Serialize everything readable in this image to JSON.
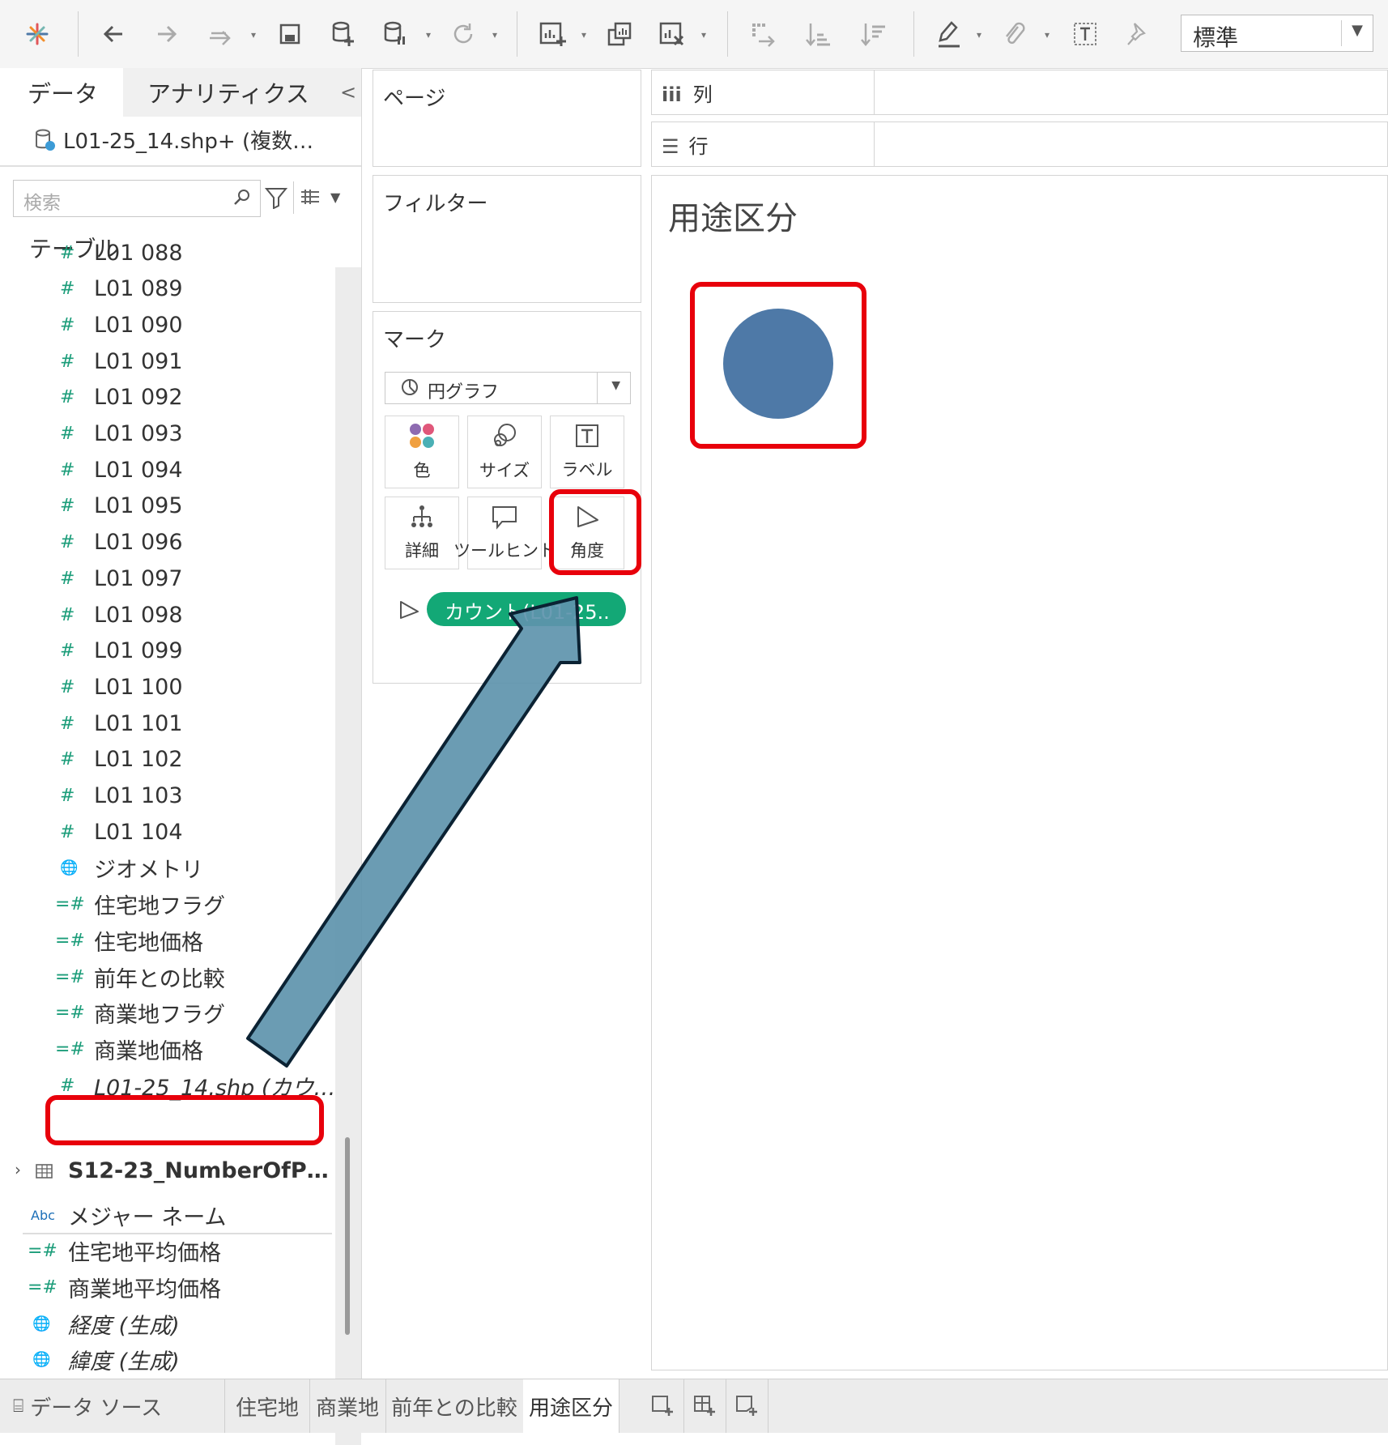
{
  "toolbar": {
    "fit_value": "標準",
    "icons": [
      "tableau-logo-icon",
      "back-icon",
      "forward-icon",
      "redo-icon",
      "save-icon",
      "new-datasource-icon",
      "pause-datasource-icon",
      "refresh-icon",
      "new-worksheet-icon",
      "duplicate-icon",
      "clear-sheet-icon",
      "swap-icon",
      "sort-asc-icon",
      "sort-desc-icon",
      "highlight-icon",
      "annotate-icon",
      "text-icon",
      "pin-icon"
    ]
  },
  "data_pane": {
    "tabs": {
      "data": "データ",
      "analytics": "アナリティクス",
      "collapse": "<"
    },
    "datasource": "L01-25_14.shp+ (複数…",
    "search_placeholder": "検索",
    "tables_header": "テーブル",
    "fields": [
      {
        "type": "measure",
        "label": "L01 088"
      },
      {
        "type": "measure",
        "label": "L01 089"
      },
      {
        "type": "measure",
        "label": "L01 090"
      },
      {
        "type": "measure",
        "label": "L01 091"
      },
      {
        "type": "measure",
        "label": "L01 092"
      },
      {
        "type": "measure",
        "label": "L01 093"
      },
      {
        "type": "measure",
        "label": "L01 094"
      },
      {
        "type": "measure",
        "label": "L01 095"
      },
      {
        "type": "measure",
        "label": "L01 096"
      },
      {
        "type": "measure",
        "label": "L01 097"
      },
      {
        "type": "measure",
        "label": "L01 098"
      },
      {
        "type": "measure",
        "label": "L01 099"
      },
      {
        "type": "measure",
        "label": "L01 100"
      },
      {
        "type": "measure",
        "label": "L01 101"
      },
      {
        "type": "measure",
        "label": "L01 102"
      },
      {
        "type": "measure",
        "label": "L01 103"
      },
      {
        "type": "measure",
        "label": "L01 104"
      },
      {
        "type": "geo",
        "label": "ジオメトリ"
      },
      {
        "type": "calc",
        "label": "住宅地フラグ"
      },
      {
        "type": "calc",
        "label": "住宅地価格"
      },
      {
        "type": "calc",
        "label": "前年との比較"
      },
      {
        "type": "calc",
        "label": "商業地フラグ"
      },
      {
        "type": "calc",
        "label": "商業地価格"
      },
      {
        "type": "measure",
        "label": "L01-25_14.shp (カウ…"
      }
    ],
    "table2": "S12-23_NumberOfP…",
    "extra_fields": [
      {
        "type": "abc",
        "label": "メジャー ネーム"
      },
      {
        "type": "calc",
        "label": "住宅地平均価格"
      },
      {
        "type": "calc",
        "label": "商業地平均価格"
      },
      {
        "type": "geo",
        "label": "経度 (生成)"
      },
      {
        "type": "geo",
        "label": "緯度 (生成)"
      }
    ],
    "abc_icon_text": "Abc"
  },
  "shelves": {
    "pages": "ページ",
    "filters": "フィルター",
    "marks": "マーク",
    "mark_type": "円グラフ",
    "buttons": {
      "color": "色",
      "size": "サイズ",
      "label": "ラベル",
      "detail": "詳細",
      "tooltip": "ツールヒント",
      "angle": "角度"
    },
    "pill": "カウント(L01-25..",
    "columns": "列",
    "rows": "行"
  },
  "view": {
    "title": "用途区分",
    "pie_color": "#4e79a7",
    "pie_share": 1.0
  },
  "tabs": {
    "datasource": "データ ソース",
    "sheets": [
      "住宅地",
      "商業地",
      "前年との比較",
      "用途区分"
    ],
    "active_index": 3
  },
  "colors": {
    "accent_red": "#e8000b",
    "pill_green": "#13a876",
    "arrow_fill": "#5e94ad"
  }
}
